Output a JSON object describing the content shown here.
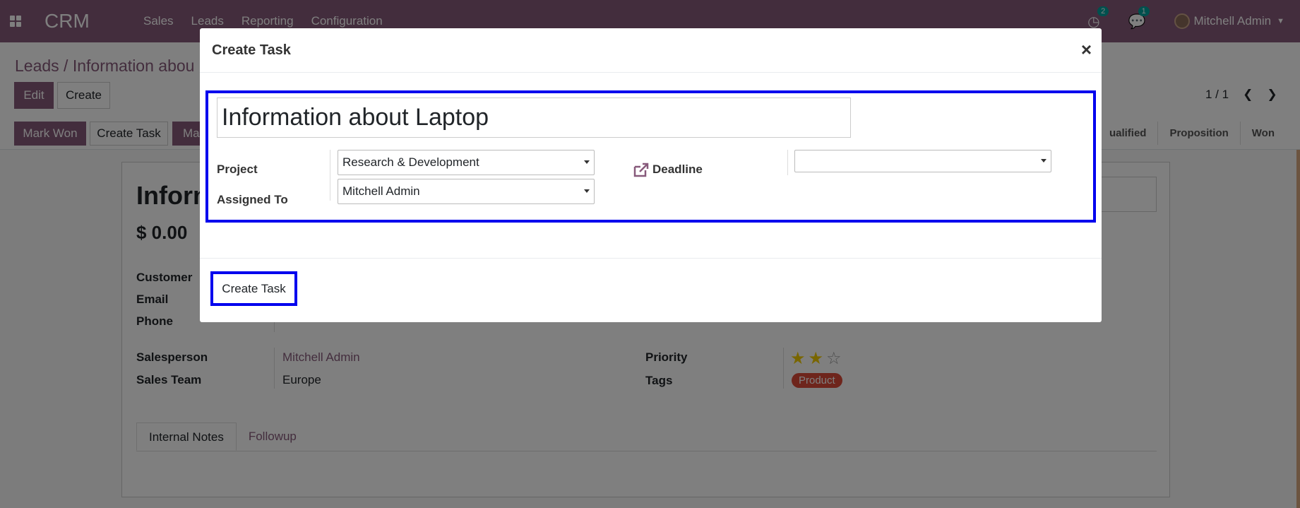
{
  "navbar": {
    "brand": "CRM",
    "menu": [
      "Sales",
      "Leads",
      "Reporting",
      "Configuration"
    ],
    "activity_count": "2",
    "message_count": "1",
    "user_name": "Mitchell Admin"
  },
  "control": {
    "breadcrumb": "Leads / Information abou",
    "edit_label": "Edit",
    "create_label": "Create",
    "pager": "1 / 1",
    "mark_won_label": "Mark Won",
    "create_task_label": "Create Task",
    "mark_lost_label": "Mar",
    "stages": [
      "ualified",
      "Proposition",
      "Won"
    ]
  },
  "sheet": {
    "title": "Inform",
    "amount": "$ 0.00",
    "customer_label": "Customer",
    "email_label": "Email",
    "phone_label": "Phone",
    "salesperson_label": "Salesperson",
    "salesperson_value": "Mitchell Admin",
    "sales_team_label": "Sales Team",
    "sales_team_value": "Europe",
    "priority_label": "Priority",
    "priority_stars": 2,
    "tags_label": "Tags",
    "tag_value": "Product",
    "tabs": [
      "Internal Notes",
      "Followup"
    ]
  },
  "modal": {
    "title": "Create Task",
    "close": "×",
    "task_name": "Information about Laptop",
    "project_label": "Project",
    "project_value": "Research & Development",
    "assigned_label": "Assigned To",
    "assigned_value": "Mitchell Admin",
    "deadline_label": "Deadline",
    "deadline_value": "",
    "submit_label": "Create Task"
  },
  "colors": {
    "brand": "#875A7B",
    "highlight": "#0000EE",
    "badge": "#00A09D",
    "tag": "#dd4b39"
  }
}
